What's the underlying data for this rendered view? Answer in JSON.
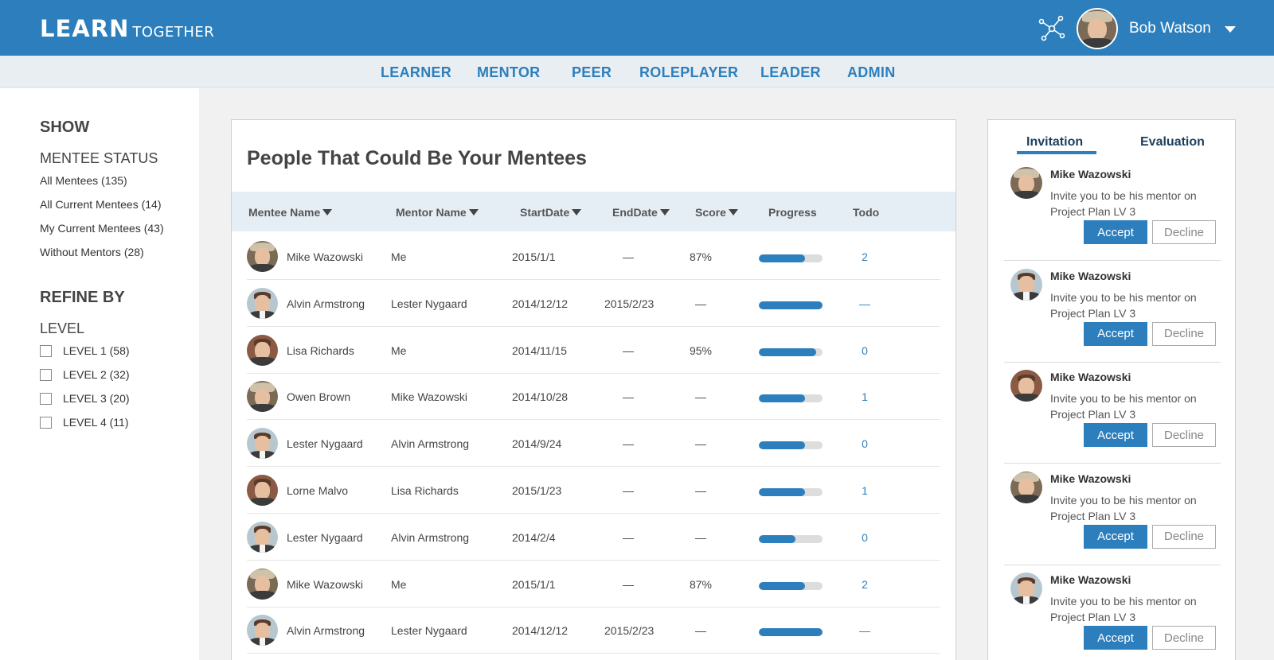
{
  "app": {
    "logo_big": "LEARN",
    "logo_small": "TOGETHER",
    "user_name": "Bob Watson"
  },
  "nav": [
    "LEARNER",
    "MENTOR",
    "PEER",
    "ROLEPLAYER",
    "LEADER",
    "ADMIN"
  ],
  "sidebar": {
    "show_title": "SHOW",
    "status_title": "MENTEE STATUS",
    "status_items": [
      "All Mentees (135)",
      "All Current Mentees (14)",
      "My Current Mentees (43)",
      "Without Mentors (28)"
    ],
    "refine_title": "REFINE BY",
    "level_title": "LEVEL",
    "levels": [
      "LEVEL 1 (58)",
      "LEVEL 2 (32)",
      "LEVEL 3 (20)",
      "LEVEL 4 (11)"
    ]
  },
  "main": {
    "title": "People That Could Be Your Mentees",
    "columns": [
      "Mentee Name",
      "Mentor Name",
      "StartDate",
      "EndDate",
      "Score",
      "Progress",
      "Todo"
    ],
    "rows": [
      {
        "mentee": "Mike Wazowski",
        "mentor": "Me",
        "start": "2015/1/1",
        "end": "—",
        "score": "87%",
        "progress": 0.72,
        "todo": "2",
        "avatar": "a"
      },
      {
        "mentee": "Alvin Armstrong",
        "mentor": "Lester Nygaard",
        "start": "2014/12/12",
        "end": "2015/2/23",
        "score": "—",
        "progress": 1.0,
        "todo": "—",
        "avatar": "b"
      },
      {
        "mentee": "Lisa Richards",
        "mentor": "Me",
        "start": "2014/11/15",
        "end": "—",
        "score": "95%",
        "progress": 0.9,
        "todo": "0",
        "avatar": "c"
      },
      {
        "mentee": "Owen Brown",
        "mentor": "Mike Wazowski",
        "start": "2014/10/28",
        "end": "—",
        "score": "—",
        "progress": 0.72,
        "todo": "1",
        "avatar": "a"
      },
      {
        "mentee": "Lester Nygaard",
        "mentor": "Alvin Armstrong",
        "start": "2014/9/24",
        "end": "—",
        "score": "—",
        "progress": 0.72,
        "todo": "0",
        "avatar": "b"
      },
      {
        "mentee": "Lorne Malvo",
        "mentor": "Lisa Richards",
        "start": "2015/1/23",
        "end": "—",
        "score": "—",
        "progress": 0.72,
        "todo": "1",
        "avatar": "c"
      },
      {
        "mentee": "Lester Nygaard",
        "mentor": "Alvin Armstrong",
        "start": "2014/2/4",
        "end": "—",
        "score": "—",
        "progress": 0.58,
        "todo": "0",
        "avatar": "b"
      },
      {
        "mentee": "Mike Wazowski",
        "mentor": "Me",
        "start": "2015/1/1",
        "end": "—",
        "score": "87%",
        "progress": 0.72,
        "todo": "2",
        "avatar": "a"
      },
      {
        "mentee": "Alvin Armstrong",
        "mentor": "Lester Nygaard",
        "start": "2014/12/12",
        "end": "2015/2/23",
        "score": "—",
        "progress": 1.0,
        "todo": "—",
        "avatar": "b"
      }
    ]
  },
  "right_panel": {
    "tabs": [
      "Invitation",
      "Evaluation"
    ],
    "accept_label": "Accept",
    "decline_label": "Decline",
    "invitations": [
      {
        "name": "Mike Wazowski",
        "message": "Invite you to be his mentor on Project Plan LV 3",
        "avatar": "a"
      },
      {
        "name": "Mike Wazowski",
        "message": "Invite you to be his mentor on Project Plan LV 3",
        "avatar": "b"
      },
      {
        "name": "Mike Wazowski",
        "message": "Invite you to be his mentor on Project Plan LV 3",
        "avatar": "c"
      },
      {
        "name": "Mike Wazowski",
        "message": "Invite you to be his mentor on Project Plan LV 3",
        "avatar": "a"
      },
      {
        "name": "Mike Wazowski",
        "message": "Invite you to be his mentor on Project Plan LV 3",
        "avatar": "b"
      }
    ]
  },
  "colors": {
    "brand": "#2c7fbc",
    "nav_bg": "#e9eef3",
    "table_header_bg": "#e6eef5"
  },
  "icons": {
    "network": "network-share-icon",
    "caret": "caret-down-icon",
    "sort": "sort-down-icon"
  }
}
